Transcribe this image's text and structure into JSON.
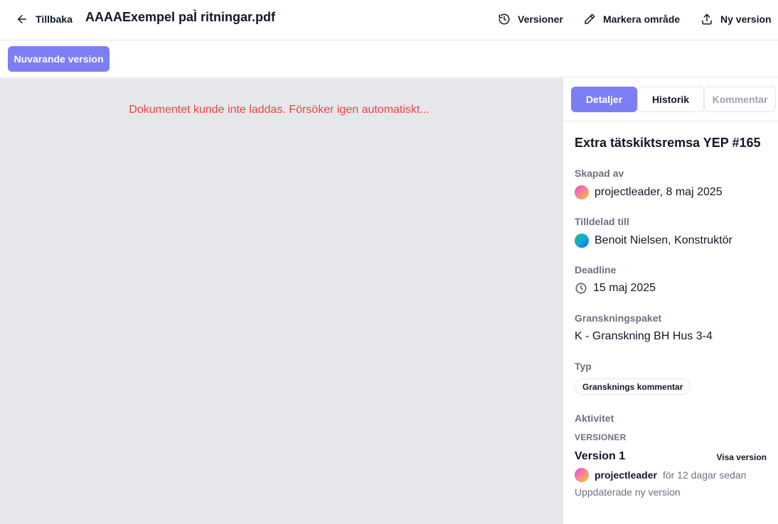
{
  "header": {
    "back_label": "Tillbaka",
    "title": "AAAAExempel paÌ ritningar.pdf",
    "actions": {
      "versions": "Versioner",
      "mark_area": "Markera område",
      "new_version": "Ny version"
    }
  },
  "toolbar": {
    "current_version_label": "Nuvarande version"
  },
  "viewer": {
    "error_message": "Dokumentet kunde inte laddas. Försöker igen automatiskt..."
  },
  "sidebar": {
    "tabs": {
      "details": "Detaljer",
      "history": "Historik",
      "comment": "Kommentar"
    },
    "issue_title": "Extra tätskiktsremsa YEP #165",
    "created_by": {
      "label": "Skapad av",
      "value": "projectleader, 8 maj 2025"
    },
    "assigned_to": {
      "label": "Tilldelad till",
      "value": "Benoit Nielsen, Konstruktör"
    },
    "deadline": {
      "label": "Deadline",
      "value": "15 maj 2025"
    },
    "review_package": {
      "label": "Granskningspaket",
      "value": "K - Granskning BH Hus 3-4"
    },
    "type": {
      "label": "Typ",
      "value": "Gransknings kommentar"
    },
    "activity": {
      "label": "Aktivitet",
      "versions_heading": "VERSIONER",
      "version": {
        "name": "Version 1",
        "show_label": "Visa version",
        "author": "projectleader",
        "time": "för 12 dagar sedan",
        "description": "Uppdaterade ny version"
      }
    }
  },
  "colors": {
    "accent": "#7c7ff3",
    "error": "#ef4444",
    "viewer_bg": "#e5e7eb",
    "muted_text": "#6b7280"
  },
  "icons": {
    "back": "arrow-left-icon",
    "versions": "history-icon",
    "mark_area": "pencil-icon",
    "new_version": "upload-icon",
    "deadline": "clock-icon"
  }
}
